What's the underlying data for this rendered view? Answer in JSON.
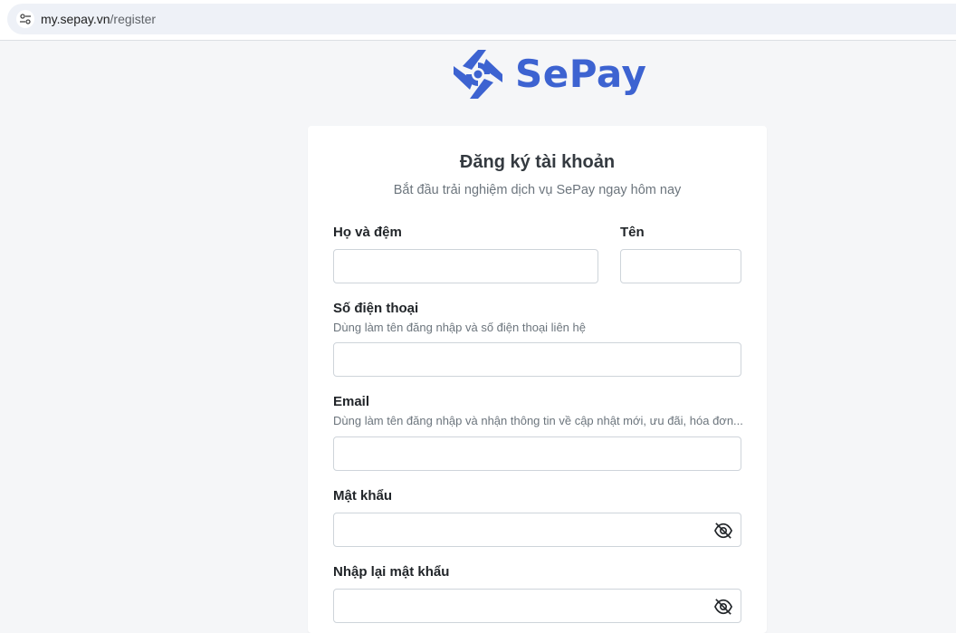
{
  "browser": {
    "url_domain": "my.sepay.vn",
    "url_path": "/register",
    "site_info_icon": "tune-icon"
  },
  "brand": {
    "name": "SePay",
    "color": "#3d63d1"
  },
  "form": {
    "title": "Đăng ký tài khoản",
    "subtitle": "Bắt đầu trải nghiệm dịch vụ SePay ngay hôm nay",
    "fields": {
      "last_name": {
        "label": "Họ và đệm",
        "value": ""
      },
      "first_name": {
        "label": "Tên",
        "value": ""
      },
      "phone": {
        "label": "Số điện thoại",
        "hint": "Dùng làm tên đăng nhập và số điện thoại liên hệ",
        "value": ""
      },
      "email": {
        "label": "Email",
        "hint": "Dùng làm tên đăng nhập và nhận thông tin về cập nhật mới, ưu đãi, hóa đơn...",
        "value": ""
      },
      "password": {
        "label": "Mật khẩu",
        "value": "",
        "icon": "eye-off-icon"
      },
      "confirm_password": {
        "label": "Nhập lại mật khẩu",
        "value": "",
        "icon": "eye-off-icon"
      }
    }
  }
}
